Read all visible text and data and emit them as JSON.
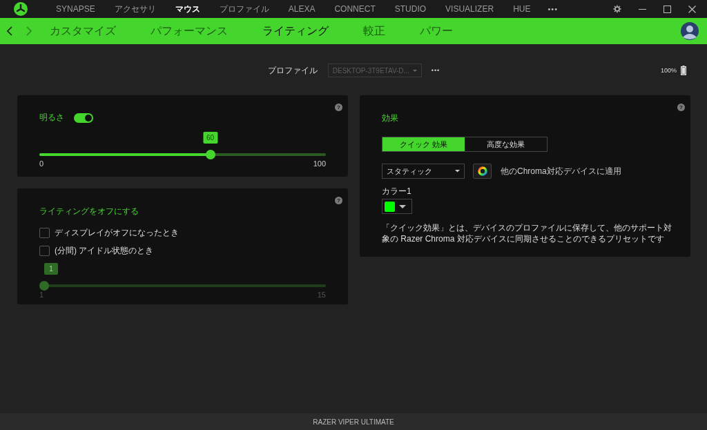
{
  "nav": {
    "tabs": [
      {
        "label": "SYNAPSE",
        "selected": false
      },
      {
        "label": "アクセサリ",
        "selected": false
      },
      {
        "label": "マウス",
        "selected": true
      },
      {
        "label": "プロファイル",
        "selected": false
      },
      {
        "label": "ALEXA",
        "selected": false
      },
      {
        "label": "CONNECT",
        "selected": false
      },
      {
        "label": "STUDIO",
        "selected": false
      },
      {
        "label": "VISUALIZER",
        "selected": false
      },
      {
        "label": "HUE",
        "selected": false
      }
    ],
    "more": "•••"
  },
  "subnav": {
    "tabs": [
      {
        "label": "カスタマイズ",
        "selected": false
      },
      {
        "label": "パフォーマンス",
        "selected": false
      },
      {
        "label": "ライティング",
        "selected": true
      },
      {
        "label": "較正",
        "selected": false
      },
      {
        "label": "パワー",
        "selected": false
      }
    ]
  },
  "profile": {
    "label": "プロファイル",
    "value": "DESKTOP-3T9ETAV-D...",
    "more": "•••"
  },
  "battery": {
    "reading": "100%"
  },
  "brightness": {
    "label": "明るさ",
    "on": true,
    "help": "?",
    "slider": {
      "level": 0.6,
      "value": "60",
      "min": "0",
      "max": "100",
      "disabled": false
    }
  },
  "lighting_off": {
    "title": "ライティングをオフにする",
    "help": "?",
    "options": [
      {
        "label": "ディスプレイがオフになったとき",
        "checked": false
      },
      {
        "label": "(分間) アイドル状態のとき",
        "checked": false
      }
    ],
    "slider": {
      "level": 0,
      "value": "1",
      "min": "1",
      "max": "15",
      "disabled": true
    }
  },
  "effects": {
    "title": "効果",
    "help": "?",
    "tabs": [
      {
        "label": "クイック 効果",
        "selected": true
      },
      {
        "label": "高度な効果",
        "selected": false
      }
    ],
    "dropdown": {
      "value": "スタティック"
    },
    "apply_label": "他のChroma対応デバイスに適用",
    "color_label": "カラー1",
    "color": "#00ff00",
    "description": "「クイック効果」とは、デバイスのプロファイルに保存して、他のサポート対象の Razer Chroma 対応デバイスに同期させることのできるプリセットです"
  },
  "status_bar": "RAZER VIPER ULTIMATE"
}
